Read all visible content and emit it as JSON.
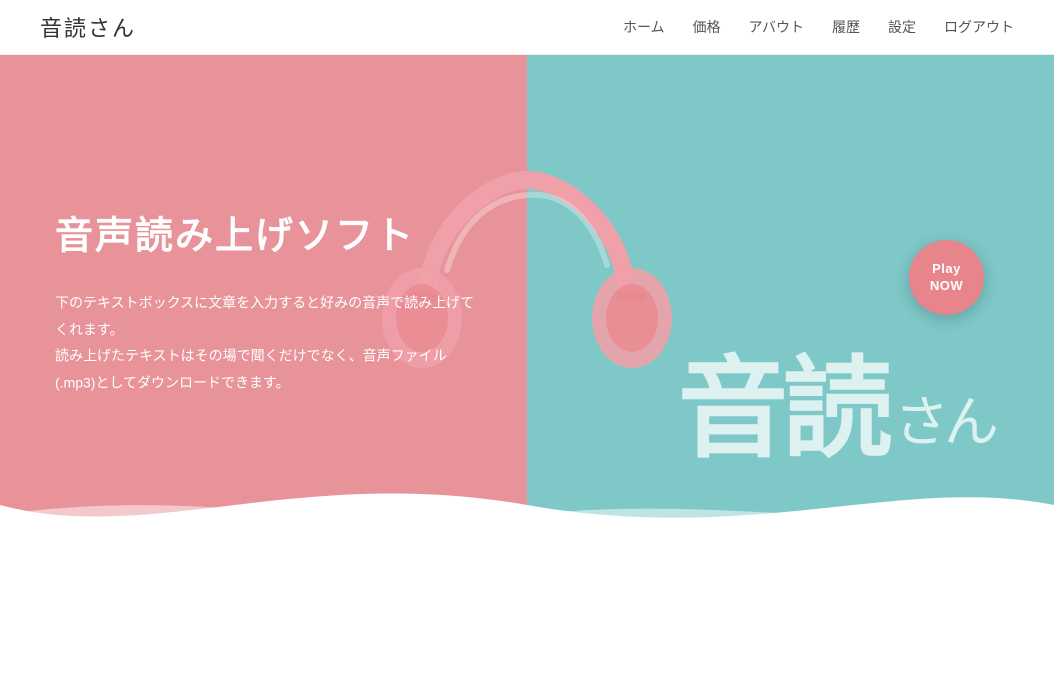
{
  "navbar": {
    "brand": "音読さん",
    "links": [
      {
        "label": "ホーム",
        "id": "nav-home"
      },
      {
        "label": "価格",
        "id": "nav-price"
      },
      {
        "label": "アバウト",
        "id": "nav-about"
      },
      {
        "label": "履歴",
        "id": "nav-history"
      },
      {
        "label": "設定",
        "id": "nav-settings"
      },
      {
        "label": "ログアウト",
        "id": "nav-logout"
      }
    ]
  },
  "hero": {
    "title": "音声読み上げソフト",
    "description_line1": "下のテキストボックスに文章を入力すると好みの音声で読み上げて",
    "description_line2": "くれます。",
    "description_line3": "読み上げたテキストはその場で聞くだけでなく、音声ファイル",
    "description_line4": "(.mp3)としてダウンロードできます。",
    "big_text_main": "音読",
    "big_text_sub": "さん",
    "play_button_line1": "Play",
    "play_button_line2": "NOW"
  },
  "colors": {
    "bg_left": "#e8939a",
    "bg_right": "#7ec8c8",
    "play_btn": "#e8848c"
  }
}
